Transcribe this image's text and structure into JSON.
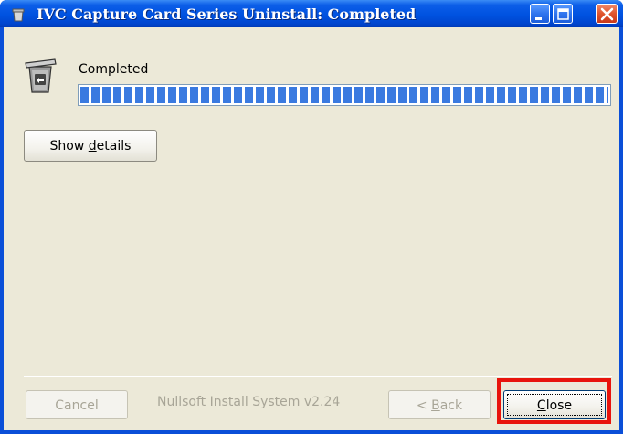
{
  "window": {
    "title": "IVC Capture Card Series Uninstall: Completed",
    "controls": {
      "minimize_icon": "minimize-icon",
      "maximize_icon": "maximize-icon",
      "close_icon": "close-x-icon"
    }
  },
  "status": {
    "label": "Completed",
    "progress_fraction": 1.0,
    "progress_color": "#3a7ae0"
  },
  "details_button": {
    "label_pre": "Show ",
    "label_accel": "d",
    "label_post": "etails"
  },
  "footer": {
    "cancel_label": "Cancel",
    "branding": "Nullsoft Install System v2.24",
    "back_label_pre": "< ",
    "back_label_accel": "B",
    "back_label_post": "ack",
    "close_label_accel": "C",
    "close_label_post": "lose"
  },
  "colors": {
    "titlebar": "#0052e0",
    "client_bg": "#ece9d8",
    "highlight_box": "#e8140c"
  }
}
